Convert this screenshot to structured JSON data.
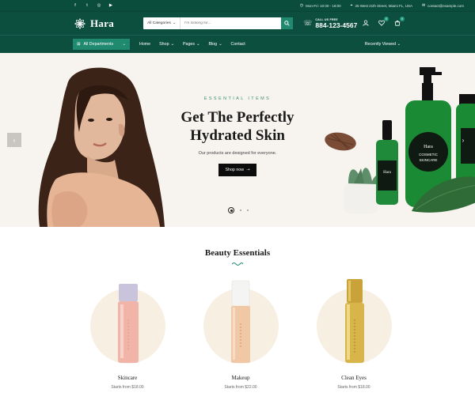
{
  "topbar": {
    "hours": "Mon-Fri: 10:00 - 18:00",
    "address": "25 West 21th Street, Miami FL, USA",
    "email": "contact@example.com",
    "socials": [
      "facebook-icon",
      "twitter-icon",
      "instagram-icon",
      "youtube-icon"
    ]
  },
  "header": {
    "logo_text": "Hara",
    "search_category": "All Categories",
    "search_placeholder": "I'm looking for...",
    "call_label": "CALL US FREE",
    "phone": "884-123-4567",
    "wishlist_count": "0",
    "cart_count": "0"
  },
  "nav": {
    "all_departments": "All Departments",
    "items": [
      {
        "label": "Home",
        "dropdown": false
      },
      {
        "label": "Shop",
        "dropdown": true
      },
      {
        "label": "Pages",
        "dropdown": true
      },
      {
        "label": "Blog",
        "dropdown": true
      },
      {
        "label": "Contact",
        "dropdown": false
      }
    ],
    "recently_viewed": "Recently Viewed"
  },
  "hero": {
    "eyebrow": "ESSENTIAL ITEMS",
    "title_line1": "Get The Perfectly",
    "title_line2": "Hydrated Skin",
    "subtitle": "Our products are designed for everyone.",
    "cta": "Shop now",
    "bottle_brand": "Hara",
    "bottle_label_1": "COSMETIC",
    "bottle_label_2": "SKINCARE"
  },
  "section": {
    "title": "Beauty Essentials"
  },
  "categories": [
    {
      "name": "Skincare",
      "price": "Starts from $18.00"
    },
    {
      "name": "Makeup",
      "price": "Starts from $22.00"
    },
    {
      "name": "Clean Eyes",
      "price": "Starts from $18.00"
    }
  ],
  "colors": {
    "brand_dark": "#0d4f3f",
    "brand_accent": "#1f8a70"
  }
}
